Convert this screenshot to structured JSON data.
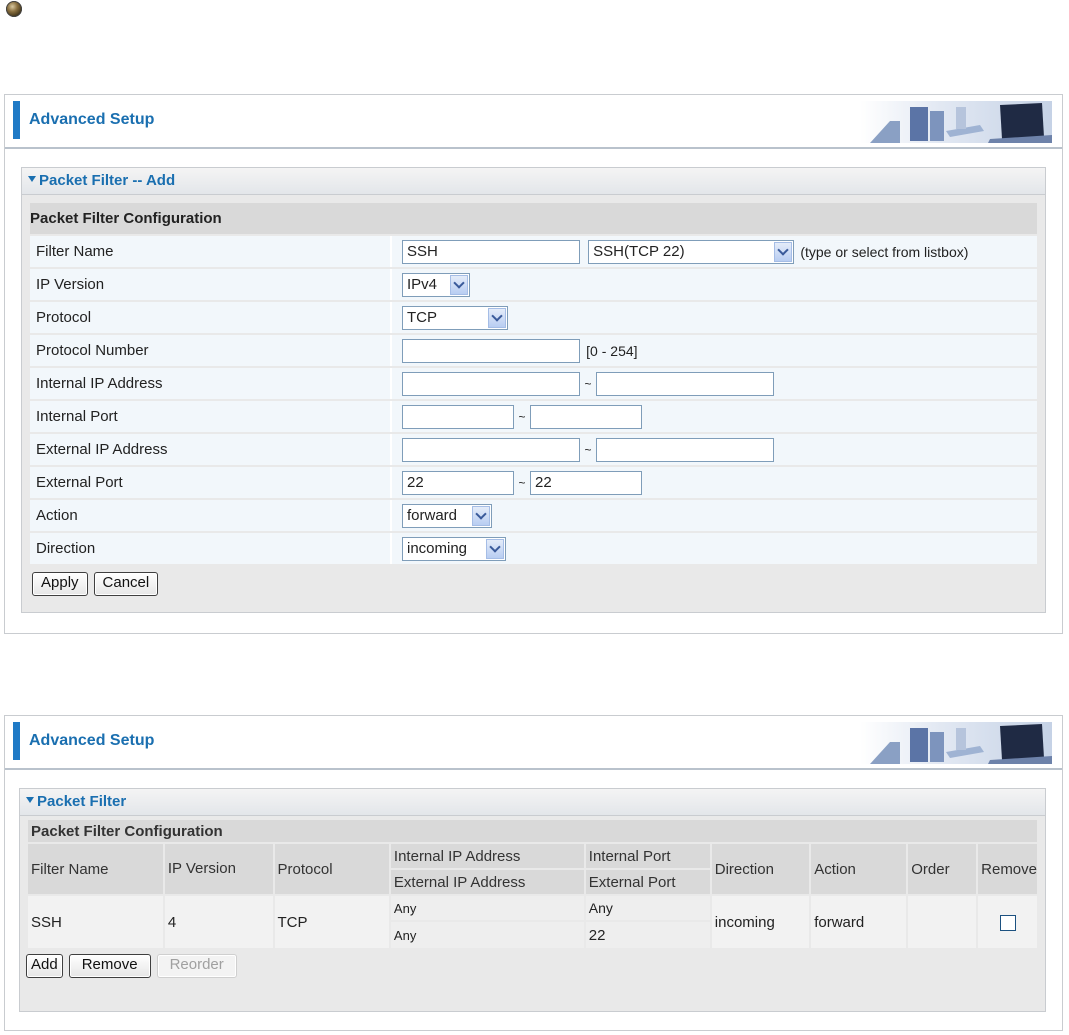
{
  "colors": {
    "accent": "#1f7ac6",
    "title_blue": "#1a6fb0"
  },
  "header_title": "Advanced Setup",
  "add_panel": {
    "section_title": "Packet Filter -- Add",
    "config_heading": "Packet Filter Configuration",
    "rows": {
      "filter_name": {
        "label": "Filter Name",
        "value": "SSH",
        "select": "SSH(TCP 22)",
        "hint": "(type or select from listbox)"
      },
      "ip_version": {
        "label": "IP Version",
        "select": "IPv4"
      },
      "protocol": {
        "label": "Protocol",
        "select": "TCP"
      },
      "protocol_number": {
        "label": "Protocol Number",
        "value": "",
        "hint": "[0 - 254]"
      },
      "internal_ip": {
        "label": "Internal IP Address",
        "from": "",
        "to": "",
        "sep": "~"
      },
      "internal_port": {
        "label": "Internal Port",
        "from": "",
        "to": "",
        "sep": "~"
      },
      "external_ip": {
        "label": "External IP Address",
        "from": "",
        "to": "",
        "sep": "~"
      },
      "external_port": {
        "label": "External Port",
        "from": "22",
        "to": "22",
        "sep": "~"
      },
      "action": {
        "label": "Action",
        "select": "forward"
      },
      "direction": {
        "label": "Direction",
        "select": "incoming"
      }
    },
    "apply_label": "Apply",
    "cancel_label": "Cancel"
  },
  "list_panel": {
    "section_title": "Packet Filter",
    "config_heading": "Packet Filter Configuration",
    "headers": {
      "filter_name": "Filter Name",
      "ip_version": "IP Version",
      "protocol": "Protocol",
      "internal_ip": "Internal IP Address",
      "external_ip": "External IP Address",
      "internal_port": "Internal Port",
      "external_port": "External Port",
      "direction": "Direction",
      "action": "Action",
      "order": "Order",
      "remove": "Remove"
    },
    "rows": [
      {
        "filter_name": "SSH",
        "ip_version": "4",
        "protocol": "TCP",
        "internal_ip": "Any",
        "external_ip": "Any",
        "internal_port": "Any",
        "external_port": "22",
        "direction": "incoming",
        "action": "forward",
        "order": ""
      }
    ],
    "add_label": "Add",
    "remove_label": "Remove",
    "reorder_label": "Reorder"
  }
}
